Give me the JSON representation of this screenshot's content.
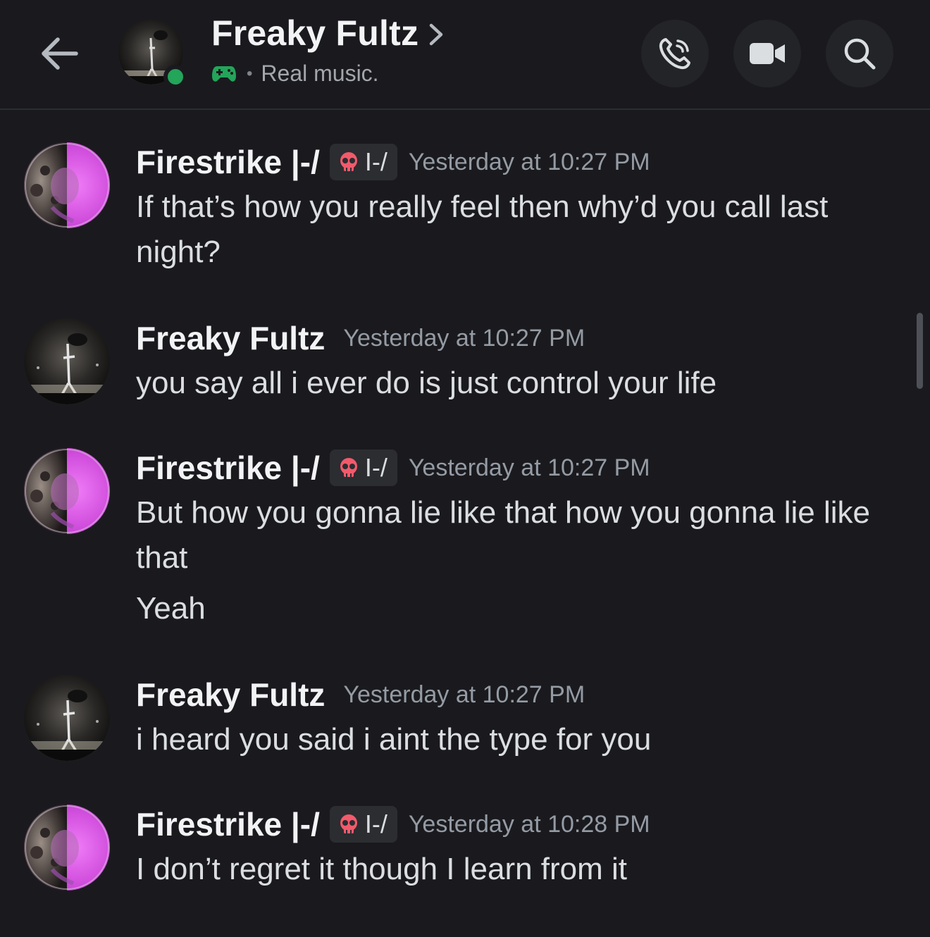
{
  "header": {
    "title": "Freaky Fultz",
    "status_text": "Real music.",
    "separator": "•"
  },
  "tags": {
    "firestrike": "I-/"
  },
  "messages": [
    {
      "author": "Firestrike |-/",
      "timestamp": "Yesterday at 10:27 PM",
      "lines": [
        "If that’s how you really feel then why’d you call last night?"
      ]
    },
    {
      "author": "Freaky Fultz",
      "timestamp": "Yesterday at 10:27 PM",
      "lines": [
        "you say all i ever do is just control your life"
      ]
    },
    {
      "author": "Firestrike |-/",
      "timestamp": "Yesterday at 10:27 PM",
      "lines": [
        "But how you gonna lie like that how you gonna lie like that",
        "Yeah"
      ]
    },
    {
      "author": "Freaky Fultz",
      "timestamp": "Yesterday at 10:27 PM",
      "lines": [
        "i heard you said i aint the type for you"
      ]
    },
    {
      "author": "Firestrike |-/",
      "timestamp": "Yesterday at 10:28 PM",
      "lines": [
        "I don’t regret it though I learn from it"
      ]
    }
  ],
  "colors": {
    "background": "#1a1a1e",
    "online": "#23a55a",
    "skull": "#f25a6b",
    "controller": "#23a55a",
    "accent_pink": "#d84fe0"
  },
  "icons": {
    "back": "arrow-left-icon",
    "call": "phone-icon",
    "video": "video-camera-icon",
    "search": "search-icon",
    "activity": "game-controller-icon",
    "tag": "skull-icon"
  }
}
